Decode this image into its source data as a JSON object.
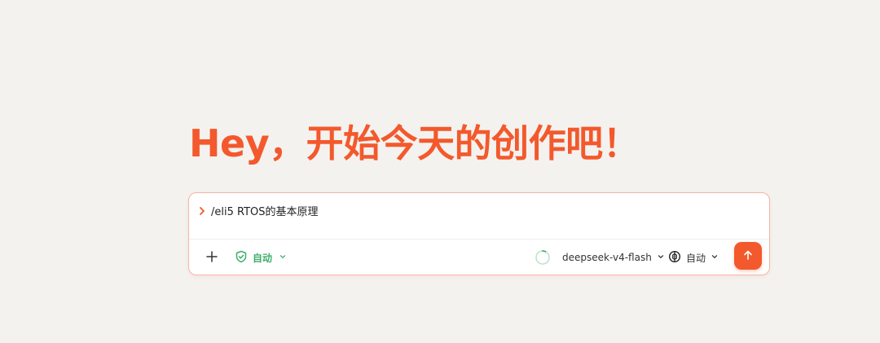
{
  "hero": {
    "title": "Hey，开始今天的创作吧！"
  },
  "composer": {
    "prompt_value": "/eli5 RTOS的基本原理",
    "toolbar": {
      "mode_label": "自动",
      "model_label": "deepseek-v4-flash",
      "thinking_label": "自动"
    }
  },
  "colors": {
    "accent": "#f3592c",
    "mode_green": "#3fae6a",
    "background": "#f4f2ef",
    "composer_border": "#f5b5a3"
  },
  "icons": {
    "prompt": "chevron-right-icon",
    "add": "plus-icon",
    "mode": "shield-check-icon",
    "spinner": "loading-spinner-icon",
    "thinking": "brain-icon",
    "send": "arrow-up-icon"
  }
}
